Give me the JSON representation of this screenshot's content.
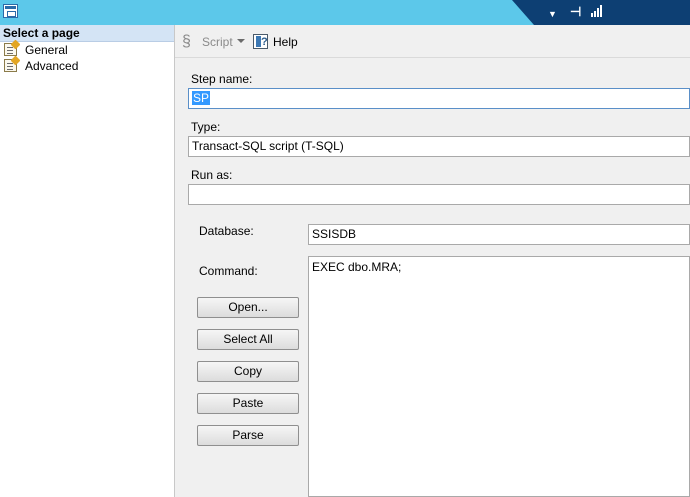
{
  "sidebar": {
    "header": "Select a page",
    "items": [
      {
        "label": "General",
        "icon": "page-icon"
      },
      {
        "label": "Advanced",
        "icon": "page-icon"
      }
    ]
  },
  "toolbar": {
    "script_label": "Script",
    "help_label": "Help"
  },
  "form": {
    "step_name_label": "Step name:",
    "step_name_value": "SP",
    "type_label": "Type:",
    "type_value": "Transact-SQL script (T-SQL)",
    "run_as_label": "Run as:",
    "run_as_value": "",
    "database_label": "Database:",
    "database_value": "SSISDB",
    "command_label": "Command:",
    "command_value": "EXEC dbo.MRA;"
  },
  "buttons": {
    "open": "Open...",
    "select_all": "Select All",
    "copy": "Copy",
    "paste": "Paste",
    "parse": "Parse"
  },
  "colors": {
    "titlebar": "#5cc8ea",
    "titlebar_tab": "#0d3f73",
    "selection": "#3399ff"
  }
}
